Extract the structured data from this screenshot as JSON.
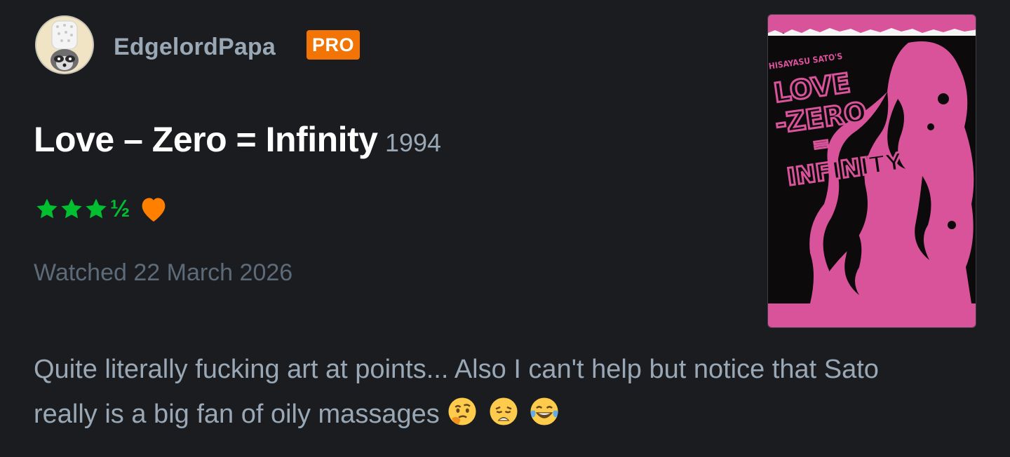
{
  "user": {
    "username": "EdgelordPapa",
    "badge": "PRO",
    "avatar_icon": "raccoon-chef-avatar-icon"
  },
  "film": {
    "title": "Love – Zero = Infinity",
    "year": "1994"
  },
  "rating": {
    "stars": 3.5,
    "half_symbol": "½",
    "liked": true,
    "star_color": "#00c030",
    "heart_color": "#ff8000"
  },
  "watched": "Watched 22 March 2026",
  "review": {
    "text": "Quite literally fucking art at points... Also I can't help but notice that Sato really is a big fan of oily massages",
    "emojis": [
      "thinking-face-emoji",
      "weary-face-emoji",
      "tears-of-joy-emoji"
    ]
  },
  "poster": {
    "byline": "HISAYASU SATO'S",
    "line1": "LOVE",
    "line2": "-ZERO",
    "line3": "=",
    "line4": "INFINITY",
    "color": "#d9539b"
  },
  "colors": {
    "background": "#1a1c20",
    "text_primary": "#ffffff",
    "text_secondary": "#9aa7b5",
    "text_muted": "#5d6a78",
    "badge": "#f27405"
  }
}
